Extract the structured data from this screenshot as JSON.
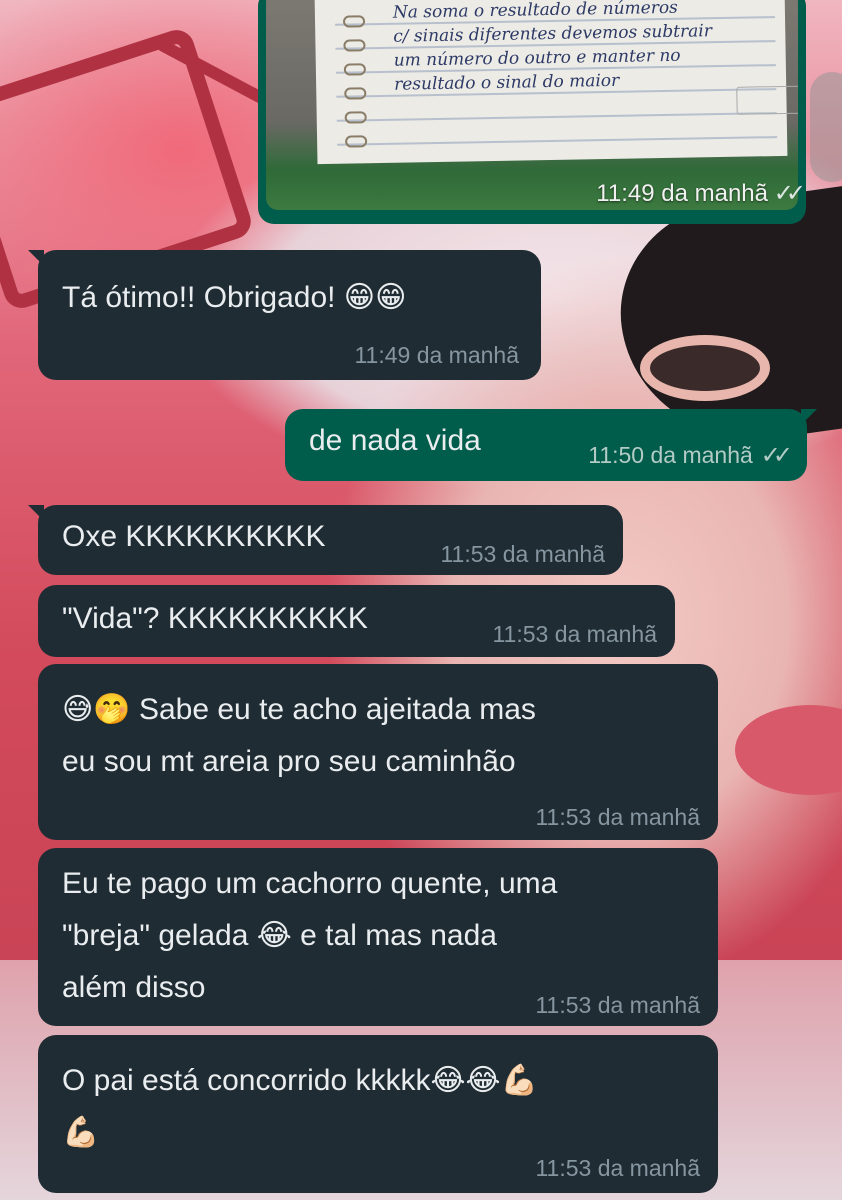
{
  "chat": {
    "image_message": {
      "handwriting": "Na soma o resultado de números\nc/ sinais diferentes devemos subtrair\num número do outro e manter no\nresultado o sinal do maior",
      "paper_logo": "",
      "time": "11:49 da manhã",
      "status_icon": "double-check-icon"
    },
    "messages": [
      {
        "text": "Tá ótimo!! Obrigado! 😁😁",
        "time": "11:49 da manhã"
      },
      {
        "text": "de nada vida",
        "time": "11:50 da manhã",
        "ticks": "✓✓"
      },
      {
        "text": "Oxe KKKKKKKKKK",
        "time": "11:53 da manhã"
      },
      {
        "text": "\"Vida\"? KKKKKKKKKK",
        "time": "11:53 da manhã"
      },
      {
        "text": "😅🤭 Sabe eu te acho ajeitada mas\neu sou mt areia pro seu caminhão",
        "time": "11:53 da manhã"
      },
      {
        "text": "Eu te pago um cachorro quente, uma\n\"breja\" gelada 😂 e tal mas nada\nalém disso",
        "time": "11:53 da manhã"
      },
      {
        "text": "O pai está concorrido kkkkk😂😂💪🏻\n💪🏻",
        "time": "11:53 da manhã"
      }
    ]
  },
  "colors": {
    "incoming_bubble": "#202c33",
    "outgoing_bubble": "#005c4b",
    "text": "#e9edef",
    "timestamp": "#8696a0"
  }
}
